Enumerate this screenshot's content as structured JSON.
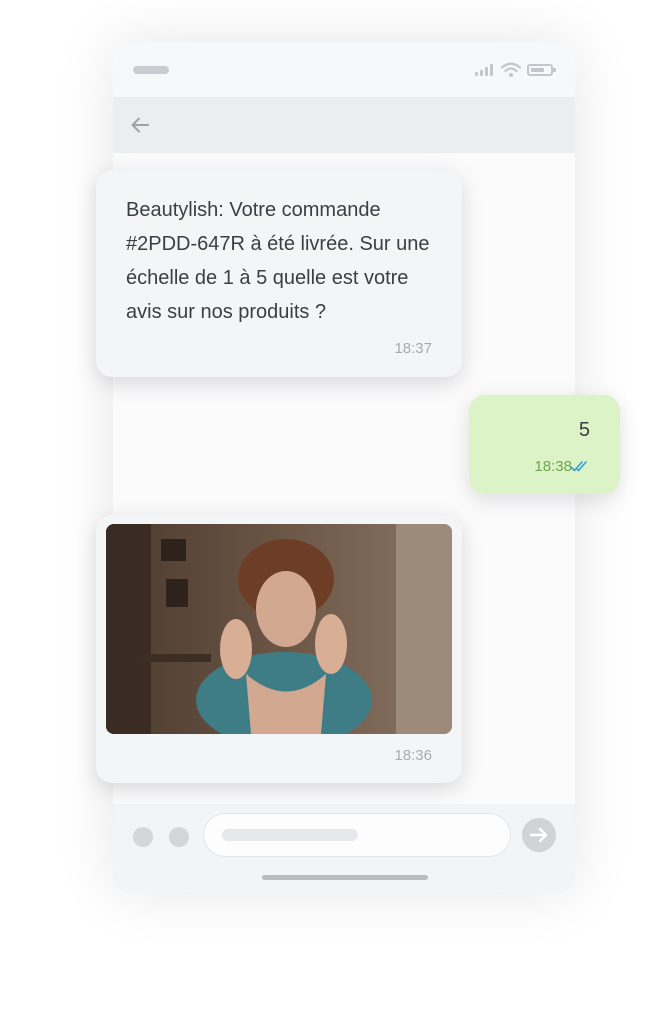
{
  "header": {
    "back_icon": "arrow-left-icon"
  },
  "messages": [
    {
      "direction": "incoming",
      "text": "Beautylish: Votre commande #2PDD-647R à été livrée. Sur une échelle de 1 à 5 quelle est votre avis sur nos produits ?",
      "time": "18:37"
    },
    {
      "direction": "outgoing",
      "text": "5",
      "time": "18:38",
      "status_icon": "double-check-icon",
      "status_color": "#3b9be0"
    },
    {
      "direction": "incoming",
      "media": "gif-image",
      "time": "18:36"
    }
  ],
  "composer": {
    "send_icon": "arrow-right-icon"
  },
  "colors": {
    "outgoing_bubble": "#dcf3c8",
    "incoming_bubble": "#f4f5f7",
    "outgoing_time": "#6da64a"
  }
}
